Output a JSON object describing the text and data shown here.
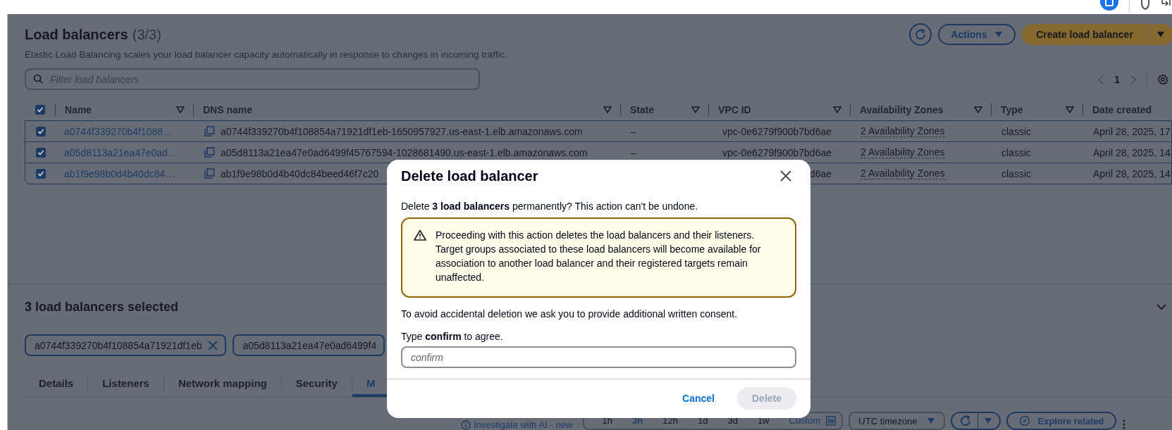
{
  "page": {
    "title": "Load balancers",
    "count": "(3/3)",
    "description": "Elastic Load Balancing scales your load balancer capacity automatically in response to changes in incoming traffic.",
    "actions": "Actions",
    "create": "Create load balancer"
  },
  "filter": {
    "placeholder": "Filter load balancers"
  },
  "pagination": {
    "page": "1"
  },
  "table": {
    "all_selected": true,
    "columns": [
      {
        "label": "Name",
        "sortable": true
      },
      {
        "label": "DNS name",
        "sortable": true
      },
      {
        "label": "State",
        "sortable": true
      },
      {
        "label": "VPC ID",
        "sortable": true
      },
      {
        "label": "Availability Zones",
        "sortable": true
      },
      {
        "label": "Type",
        "sortable": true
      },
      {
        "label": "Date created",
        "sortable": false
      }
    ],
    "rows": [
      {
        "selected": true,
        "name": "a0744f339270b4f1088…",
        "dns": "a0744f339270b4f108854a71921df1eb-1650957927.us-east-1.elb.amazonaws.com",
        "state": "–",
        "vpc": "vpc-0e6279f900b7bd6ae",
        "zones": "2 Availability Zones",
        "type": "classic",
        "created": "April 28, 2025, 17"
      },
      {
        "selected": true,
        "name": "a05d8113a21ea47e0ad…",
        "dns": "a05d8113a21ea47e0ad6499f45767594-1028681490.us-east-1.elb.amazonaws.com",
        "state": "–",
        "vpc": "vpc-0e6279f900b7bd6ae",
        "zones": "2 Availability Zones",
        "type": "classic",
        "created": "April 28, 2025, 14"
      },
      {
        "selected": true,
        "name": "ab1f9e98b0d4b40dc84…",
        "dns": "ab1f9e98b0d4b40dc84beed46f7c20",
        "state": "",
        "vpc": "d6ae",
        "zones": "2 Availability Zones",
        "type": "classic",
        "created": "April 28, 2025, 14"
      }
    ]
  },
  "selection": {
    "title": "3 load balancers selected",
    "tokens": [
      {
        "label": "a0744f339270b4f108854a71921df1eb",
        "dismissible": true
      },
      {
        "label": "a05d8113a21ea47e0ad6499f4",
        "dismissible": false
      }
    ]
  },
  "tabs": [
    {
      "label": "Details",
      "selected": false
    },
    {
      "label": "Listeners",
      "selected": false
    },
    {
      "label": "Network mapping",
      "selected": false
    },
    {
      "label": "Security",
      "selected": false
    },
    {
      "label": "M",
      "selected": true
    }
  ],
  "toolbar": {
    "investigate": "Investigate with AI - *new*",
    "ranges": [
      {
        "label": "1h",
        "selected": false
      },
      {
        "label": "3h",
        "selected": true
      },
      {
        "label": "12h",
        "selected": false
      },
      {
        "label": "1d",
        "selected": false
      },
      {
        "label": "3d",
        "selected": false
      },
      {
        "label": "1w",
        "selected": false
      }
    ],
    "custom": "Custom",
    "timezone": "UTC timezone",
    "explore": "Explore related"
  },
  "modal": {
    "title": "Delete load balancer",
    "intro": "Delete **3 load balancers** permanently? This action can't be undone.",
    "warning": "Proceeding with this action deletes the load balancers and their listeners. Target groups associated to these load balancers will become available for association to another load balancer and their registered targets remain unaffected.",
    "consent": "To avoid accidental deletion we ask you to provide additional written consent.",
    "prompt": "Type **confirm** to agree.",
    "input": {
      "placeholder": "confirm"
    },
    "cancel": "Cancel",
    "delete": {
      "label": "Delete",
      "disabled": true
    }
  }
}
